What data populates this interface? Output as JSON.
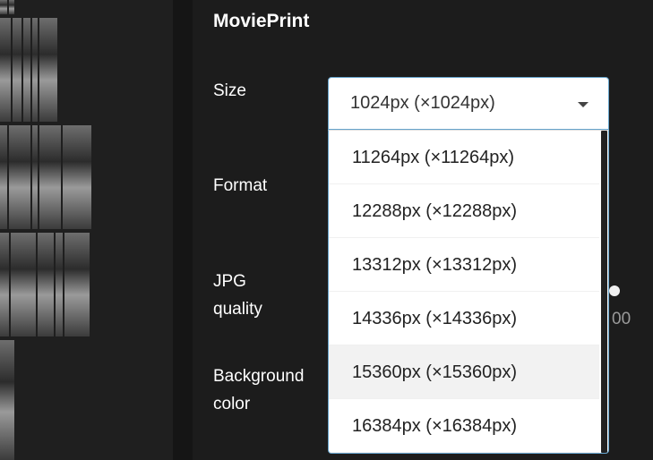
{
  "panel": {
    "title": "MoviePrint",
    "labels": {
      "size": "Size",
      "format": "Format",
      "jpg_quality_line1": "JPG",
      "jpg_quality_line2": "quality",
      "background_color_line1": "Background",
      "background_color_line2": "color"
    },
    "jpg_quality_value_fragment": "00"
  },
  "size_select": {
    "selected": "1024px (×1024px)",
    "options": [
      "11264px (×11264px)",
      "12288px (×12288px)",
      "13312px (×13312px)",
      "14336px (×14336px)",
      "15360px (×15360px)",
      "16384px (×16384px)"
    ],
    "hovered_index": 4
  },
  "colors": {
    "focus_border": "#66a4cc",
    "panel_bg": "#1c1c1c",
    "hover_bg": "#f2f2f2"
  }
}
